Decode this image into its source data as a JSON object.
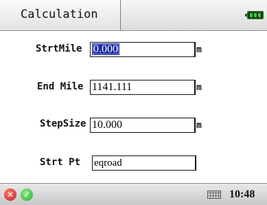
{
  "header": {
    "tab_label": "Calculation",
    "battery_icon": "battery-icon"
  },
  "form": {
    "start_mile": {
      "label": "StrtMile",
      "value": "0.000",
      "unit": "m"
    },
    "end_mile": {
      "label": "End Mile",
      "value": "1141.111",
      "unit": "m"
    },
    "step_size": {
      "label": "StepSize",
      "value": "10.000",
      "unit": "m"
    },
    "start_point": {
      "label": "Strt Pt",
      "value": "eqroad"
    }
  },
  "footer": {
    "cancel_icon": "close-icon",
    "ok_icon": "check-icon",
    "keyboard_icon": "keyboard-icon",
    "time": "10:48"
  },
  "colors": {
    "selection": "#1a2aa8",
    "battery": "#2fcf2f",
    "cancel": "#d9342b",
    "ok": "#3cbf3c"
  }
}
